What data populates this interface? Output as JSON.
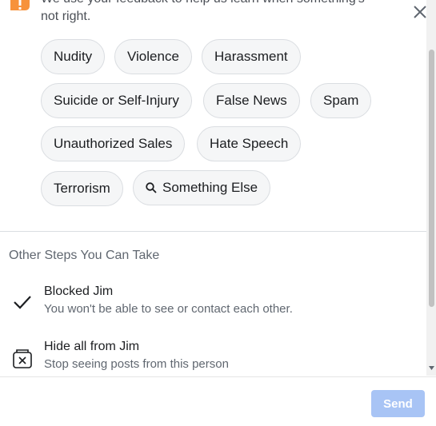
{
  "header": {
    "text": "We use your feedback to help us learn when something's not right."
  },
  "tags": [
    "Nudity",
    "Violence",
    "Harassment",
    "Suicide or Self-Injury",
    "False News",
    "Spam",
    "Unauthorized Sales",
    "Hate Speech",
    "Terrorism",
    "Something Else"
  ],
  "other_steps": {
    "title": "Other Steps You Can Take",
    "items": [
      {
        "title": "Blocked Jim",
        "subtitle": "You won't be able to see or contact each other.",
        "icon": "checkmark-icon"
      },
      {
        "title": "Hide all from Jim",
        "subtitle": "Stop seeing posts from this person",
        "icon": "hide-box-icon"
      }
    ]
  },
  "footer": {
    "send_label": "Send"
  },
  "colors": {
    "warning": "#f7923b",
    "send_disabled": "#a8c4f5",
    "tag_bg": "#f5f6f7"
  }
}
